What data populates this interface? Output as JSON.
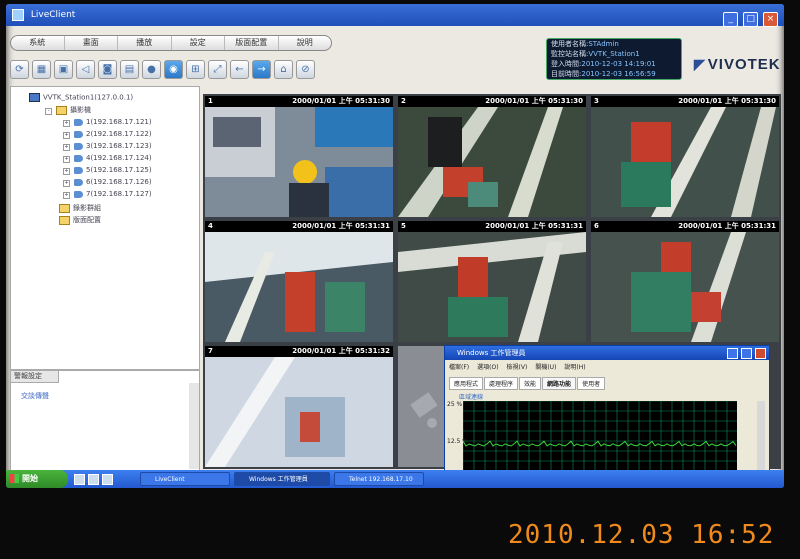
{
  "window": {
    "title": "LiveClient",
    "min": "_",
    "max": "□",
    "close": "×"
  },
  "menu": [
    "系統",
    "畫面",
    "播放",
    "設定",
    "版面配置",
    "說明"
  ],
  "toolbar_icons": [
    "refresh-icon",
    "layout-icon",
    "lock-icon",
    "audio-icon",
    "snapshot-icon",
    "print-icon",
    "record-icon",
    "camera-active-icon",
    "grid-icon",
    "fullscreen-icon",
    "back-icon",
    "forward-icon",
    "patrol-icon",
    "disable-icon"
  ],
  "info": {
    "rows": [
      {
        "label": "使用者名稱:",
        "value": "STAdmin"
      },
      {
        "label": "監控站名稱:",
        "value": "VVTK_Station1"
      },
      {
        "label": "登入時間:",
        "value": "2010-12-03 14:19:01"
      },
      {
        "label": "目前時間:",
        "value": "2010-12-03 16:56:59"
      }
    ]
  },
  "logo": {
    "text": "VIVOTEK"
  },
  "tree": {
    "root": "VVTK_Station1(127.0.0.1)",
    "group": "攝影機",
    "cameras": [
      "1(192.168.17.121)",
      "2(192.168.17.122)",
      "3(192.168.17.123)",
      "4(192.168.17.124)",
      "5(192.168.17.125)",
      "6(192.168.17.126)",
      "7(192.168.17.127)"
    ],
    "folders": [
      "錄影群組",
      "版面配置"
    ]
  },
  "panel2": {
    "tab": "警報設定",
    "label": "交談傳聲"
  },
  "tiles": [
    {
      "num": "1",
      "ts": "2000/01/01 上午 05:31:30"
    },
    {
      "num": "2",
      "ts": "2000/01/01 上午 05:31:30"
    },
    {
      "num": "3",
      "ts": "2000/01/01 上午 05:31:30"
    },
    {
      "num": "4",
      "ts": "2000/01/01 上午 05:31:31"
    },
    {
      "num": "5",
      "ts": "2000/01/01 上午 05:31:31"
    },
    {
      "num": "6",
      "ts": "2000/01/01 上午 05:31:31"
    },
    {
      "num": "7",
      "ts": "2000/01/01 上午 05:31:32"
    }
  ],
  "taskmgr": {
    "title": "Windows 工作管理員",
    "menu": [
      "檔案(F)",
      "選項(O)",
      "檢視(V)",
      "關機(U)",
      "說明(H)"
    ],
    "tabs": [
      "應用程式",
      "處理程序",
      "效能",
      "網路功能",
      "使用者"
    ],
    "sub": "區域連線",
    "y_top": "25 %",
    "y_mid": "12.5 %"
  },
  "taskbar": {
    "start": "開始",
    "tasks": [
      "LiveClient",
      "Windows 工作管理員",
      "Telnet 192.168.17.10"
    ]
  },
  "photo_stamp": "2010.12.03  16:52",
  "colors": {
    "accent": "#2a78c8",
    "selected_tile": "#b53030",
    "graph_line": "#3bd43b",
    "graph_grid": "#0c8a5a"
  }
}
